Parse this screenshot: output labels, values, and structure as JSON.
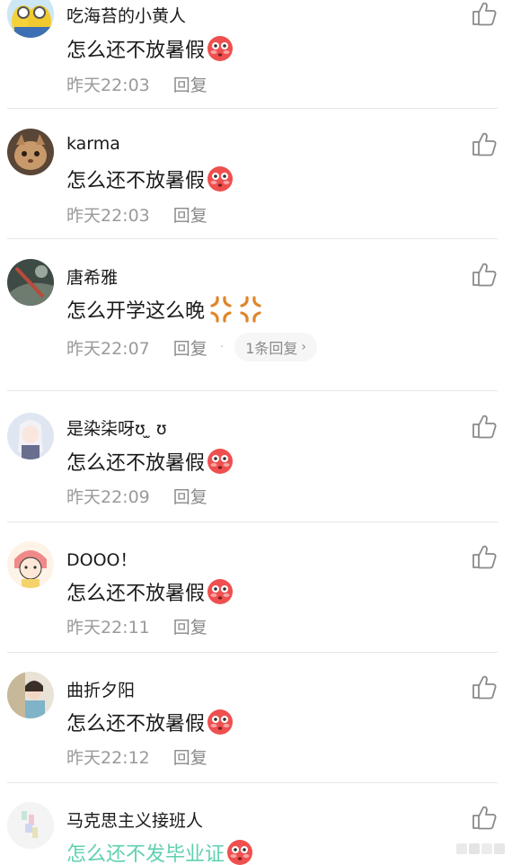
{
  "comments": [
    {
      "username": "吃海苔的小黄人",
      "text": "怎么还不放暑假",
      "emoji": "flushed-face",
      "time": "昨天22:03",
      "reply": "回复"
    },
    {
      "username": "karma",
      "text": "怎么还不放暑假",
      "emoji": "flushed-face",
      "time": "昨天22:03",
      "reply": "回复"
    },
    {
      "username": "唐希雅",
      "text": "怎么开学这么晚",
      "emoji": "anger-symbol",
      "time": "昨天22:07",
      "reply": "回复",
      "replies_count": "1条回复"
    },
    {
      "username": "是染柒呀ʊ ̫ ʊ",
      "text": "怎么还不放暑假",
      "emoji": "flushed-face",
      "time": "昨天22:09",
      "reply": "回复"
    },
    {
      "username": "DOOO！",
      "text": "怎么还不放暑假",
      "emoji": "flushed-face",
      "time": "昨天22:11",
      "reply": "回复"
    },
    {
      "username": "曲折夕阳",
      "text": "怎么还不放暑假",
      "emoji": "flushed-face",
      "time": "昨天22:12",
      "reply": "回复"
    },
    {
      "username": "马克思主义接班人",
      "text": "怎么还不发毕业证",
      "emoji": "flushed-face",
      "time": "",
      "reply": ""
    }
  ],
  "colors": {
    "highlight_text": "#5fd0b0",
    "meta_text": "#9a9a9a",
    "divider": "#e6e6e6"
  },
  "icons": {
    "like": "thumbs-up-icon",
    "flushed": "flushed-face-emoji",
    "anger": "anger-symbol-emoji"
  }
}
